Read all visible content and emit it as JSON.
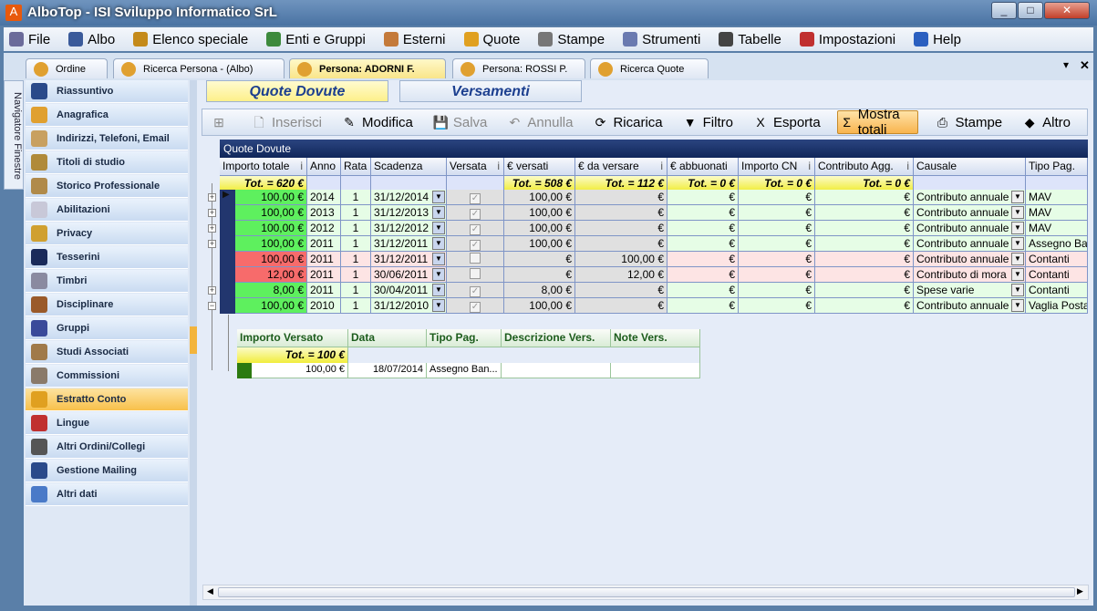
{
  "window": {
    "title": "AlboTop - ISI Sviluppo Informatico SrL",
    "controls": [
      "_",
      "□",
      "✕"
    ]
  },
  "menu": [
    {
      "label": "File",
      "color": "#6b6b9a"
    },
    {
      "label": "Albo",
      "color": "#3a5a9a"
    },
    {
      "label": "Elenco speciale",
      "color": "#c48a1a"
    },
    {
      "label": "Enti e Gruppi",
      "color": "#3d8a3d"
    },
    {
      "label": "Esterni",
      "color": "#c47a3a"
    },
    {
      "label": "Quote",
      "color": "#e0a020"
    },
    {
      "label": "Stampe",
      "color": "#777"
    },
    {
      "label": "Strumenti",
      "color": "#6a7ab0"
    },
    {
      "label": "Tabelle",
      "color": "#444"
    },
    {
      "label": "Impostazioni",
      "color": "#c03030"
    },
    {
      "label": "Help",
      "color": "#2a5fc0"
    }
  ],
  "doc_tabs": [
    {
      "label": "Ordine",
      "active": false
    },
    {
      "label": "Ricerca Persona - (Albo)",
      "active": false
    },
    {
      "label": "Persona: ADORNI F.",
      "active": true
    },
    {
      "label": "Persona: ROSSI P.",
      "active": false
    },
    {
      "label": "Ricerca Quote",
      "active": false
    }
  ],
  "doc_tabs_controls": [
    "▾",
    "✕"
  ],
  "navigator_label": "Navigatore Finestre",
  "sidebar": [
    {
      "label": "Riassuntivo",
      "color": "#2a4a8a"
    },
    {
      "label": "Anagrafica",
      "color": "#e0a030"
    },
    {
      "label": "Indirizzi, Telefoni, Email",
      "color": "#c8a060"
    },
    {
      "label": "Titoli di studio",
      "color": "#b08a3a"
    },
    {
      "label": "Storico Professionale",
      "color": "#b08a4a"
    },
    {
      "label": "Abilitazioni",
      "color": "#c8c8d8"
    },
    {
      "label": "Privacy",
      "color": "#d0a030"
    },
    {
      "label": "Tesserini",
      "color": "#1a2a5a"
    },
    {
      "label": "Timbri",
      "color": "#8a8aa0"
    },
    {
      "label": "Disciplinare",
      "color": "#9a5a2a"
    },
    {
      "label": "Gruppi",
      "color": "#3a4a9a"
    },
    {
      "label": "Studi Associati",
      "color": "#a07a4a"
    },
    {
      "label": "Commissioni",
      "color": "#8a7a6a"
    },
    {
      "label": "Estratto Conto",
      "color": "#e0a020",
      "selected": true
    },
    {
      "label": "Lingue",
      "color": "#c03030"
    },
    {
      "label": "Altri Ordini/Collegi",
      "color": "#555"
    },
    {
      "label": "Gestione Mailing",
      "color": "#2a4a8a"
    },
    {
      "label": "Altri dati",
      "color": "#4a7ac8"
    }
  ],
  "sub_tabs": [
    {
      "label": "Quote Dovute",
      "active": true
    },
    {
      "label": "Versamenti",
      "active": false
    }
  ],
  "toolbar": [
    {
      "label": "",
      "icon": "⊞",
      "name": "expand",
      "disabled": true
    },
    {
      "label": "Inserisci",
      "icon": "🗋",
      "name": "insert",
      "disabled": true
    },
    {
      "label": "Modifica",
      "icon": "✎",
      "name": "edit"
    },
    {
      "label": "Salva",
      "icon": "💾",
      "name": "save",
      "disabled": true
    },
    {
      "label": "Annulla",
      "icon": "↶",
      "name": "undo",
      "disabled": true
    },
    {
      "label": "Ricarica",
      "icon": "⟳",
      "name": "reload"
    },
    {
      "label": "Filtro",
      "icon": "▼",
      "name": "filter"
    },
    {
      "label": "Esporta",
      "icon": "X",
      "name": "export"
    },
    {
      "label": "Mostra totali",
      "icon": "Σ",
      "name": "show-totals",
      "hot": true
    },
    {
      "label": "Stampe",
      "icon": "⎙",
      "name": "print"
    },
    {
      "label": "Altro",
      "icon": "◆",
      "name": "more"
    }
  ],
  "grid": {
    "caption": "Quote Dovute",
    "columns": [
      "Importo totale",
      "Anno",
      "Rata",
      "Scadenza",
      "Versata",
      "€ versati",
      "€ da versare",
      "€ abbuonati",
      "Importo CN",
      "Contributo Agg.",
      "Causale",
      "Tipo Pag."
    ],
    "info_columns": [
      0,
      4,
      6,
      8,
      9
    ],
    "totals": [
      "Tot. = 620 €",
      "",
      "",
      "",
      "",
      "Tot. = 508 €",
      "Tot. = 112 €",
      "Tot. = 0 €",
      "Tot. = 0 €",
      "Tot. = 0 €",
      "",
      ""
    ],
    "rows": [
      {
        "status": "paid",
        "expander": "+",
        "cells": [
          "100,00 €",
          "2014",
          "1",
          "31/12/2014",
          true,
          "100,00 €",
          "€",
          "€",
          "€",
          "€",
          "Contributo annuale",
          "MAV"
        ]
      },
      {
        "status": "paid",
        "expander": "+",
        "cells": [
          "100,00 €",
          "2013",
          "1",
          "31/12/2013",
          true,
          "100,00 €",
          "€",
          "€",
          "€",
          "€",
          "Contributo annuale",
          "MAV"
        ]
      },
      {
        "status": "paid",
        "expander": "+",
        "cells": [
          "100,00 €",
          "2012",
          "1",
          "31/12/2012",
          true,
          "100,00 €",
          "€",
          "€",
          "€",
          "€",
          "Contributo annuale",
          "MAV"
        ]
      },
      {
        "status": "paid",
        "expander": "+",
        "cells": [
          "100,00 €",
          "2011",
          "1",
          "31/12/2011",
          true,
          "100,00 €",
          "€",
          "€",
          "€",
          "€",
          "Contributo annuale",
          "Assegno Ba"
        ]
      },
      {
        "status": "unpaid",
        "expander": "",
        "cells": [
          "100,00 €",
          "2011",
          "1",
          "31/12/2011",
          false,
          "€",
          "100,00 €",
          "€",
          "€",
          "€",
          "Contributo annuale",
          "Contanti"
        ]
      },
      {
        "status": "unpaid",
        "expander": "",
        "cells": [
          "12,00 €",
          "2011",
          "1",
          "30/06/2011",
          false,
          "€",
          "12,00 €",
          "€",
          "€",
          "€",
          "Contributo di mora",
          "Contanti"
        ]
      },
      {
        "status": "paid",
        "expander": "+",
        "cells": [
          "8,00 €",
          "2011",
          "1",
          "30/04/2011",
          true,
          "8,00 €",
          "€",
          "€",
          "€",
          "€",
          "Spese varie",
          "Contanti"
        ]
      },
      {
        "status": "paid",
        "expander": "−",
        "cells": [
          "100,00 €",
          "2010",
          "1",
          "31/12/2010",
          true,
          "100,00 €",
          "€",
          "€",
          "€",
          "€",
          "Contributo annuale",
          "Vaglia Posta"
        ]
      }
    ],
    "colors": {
      "paid": "#5ef05e",
      "unpaid": "#f76b6b",
      "paid_row": "#e6fde6",
      "unpaid_row": "#fde4e4",
      "readonly": "#e0e0e0",
      "header_dark": "#10265a"
    }
  },
  "detail": {
    "columns": [
      "Importo Versato",
      "Data",
      "Tipo Pag.",
      "Descrizione Vers.",
      "Note Vers."
    ],
    "totals": "Tot. = 100 €",
    "rows": [
      [
        "100,00 €",
        "18/07/2014",
        "Assegno Ban...",
        "",
        ""
      ]
    ]
  }
}
